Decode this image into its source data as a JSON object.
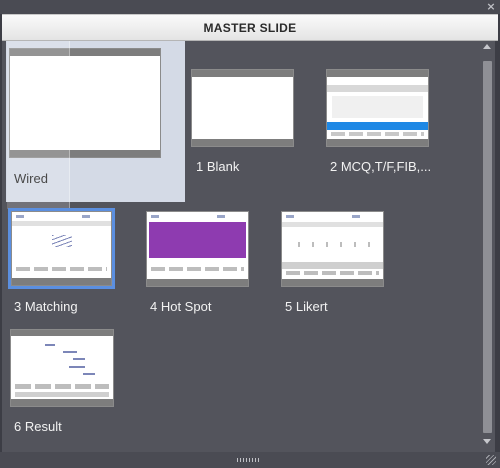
{
  "header": {
    "title": "MASTER SLIDE"
  },
  "window": {
    "close_label": "×"
  },
  "slides": [
    {
      "label": "Wired"
    },
    {
      "label": "1 Blank"
    },
    {
      "label": "2 MCQ,T/F,FIB,..."
    },
    {
      "label": "3 Matching"
    },
    {
      "label": "4 Hot Spot"
    },
    {
      "label": "5 Likert"
    },
    {
      "label": "6 Result"
    }
  ],
  "colors": {
    "content_bg": "#53545c",
    "selected_bg": "#d4dae6",
    "focus_border": "#5b8fe0",
    "hotspot_purple": "#8e3bb0",
    "mcq_blue": "#1e88e5"
  }
}
